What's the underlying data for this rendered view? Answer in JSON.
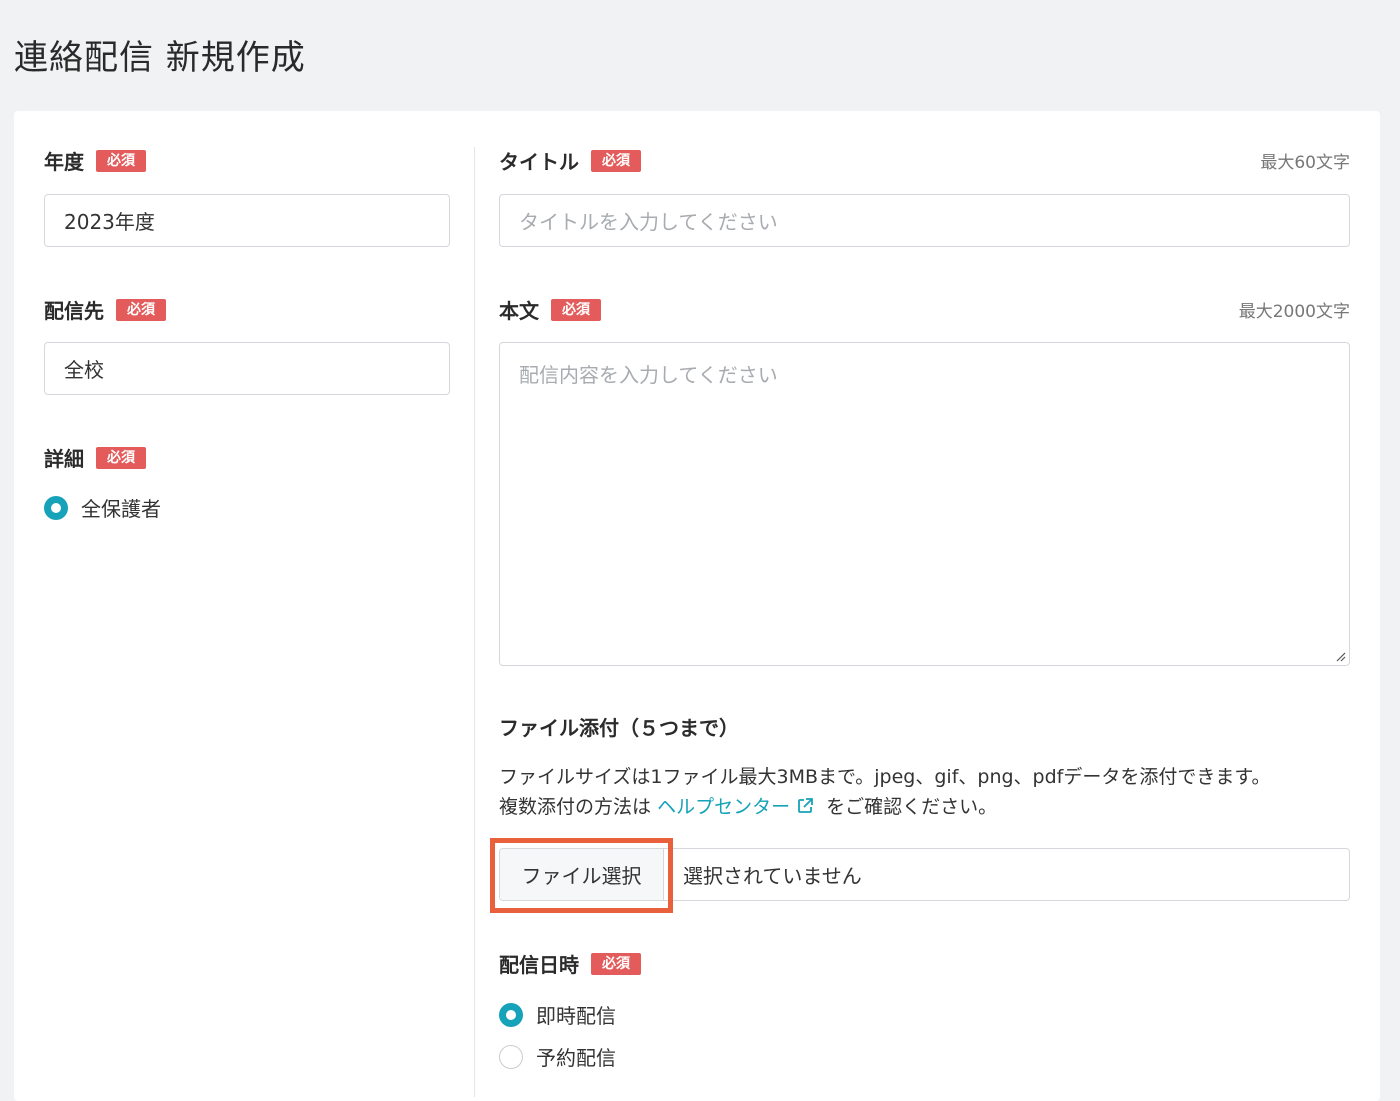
{
  "page": {
    "title": "連絡配信 新規作成"
  },
  "colors": {
    "accent": "#16a2b8",
    "badge": "#e35b5b",
    "highlight": "#e8603c"
  },
  "required_badge": "必須",
  "year": {
    "label": "年度",
    "value": "2023年度"
  },
  "destination": {
    "label": "配信先",
    "value": "全校"
  },
  "detail": {
    "label": "詳細",
    "option": "全保護者",
    "selected": true
  },
  "title_field": {
    "label": "タイトル",
    "limit": "最大60文字",
    "placeholder": "タイトルを入力してください"
  },
  "body_field": {
    "label": "本文",
    "limit": "最大2000文字",
    "placeholder": "配信内容を入力してください"
  },
  "attachment": {
    "title": "ファイル添付（５つまで）",
    "desc_line1": "ファイルサイズは1ファイル最大3MBまで。jpeg、gif、png、pdfデータを添付できます。",
    "desc_line2_prefix": "複数添付の方法は",
    "help_link": "ヘルプセンター",
    "desc_line2_suffix": "をご確認ください。",
    "button_label": "ファイル選択",
    "status": "選択されていません"
  },
  "schedule": {
    "label": "配信日時",
    "options": [
      {
        "label": "即時配信",
        "selected": true
      },
      {
        "label": "予約配信",
        "selected": false
      }
    ]
  },
  "icons": {
    "external_link": "external-link-icon",
    "resize": "resize-grip-icon"
  }
}
